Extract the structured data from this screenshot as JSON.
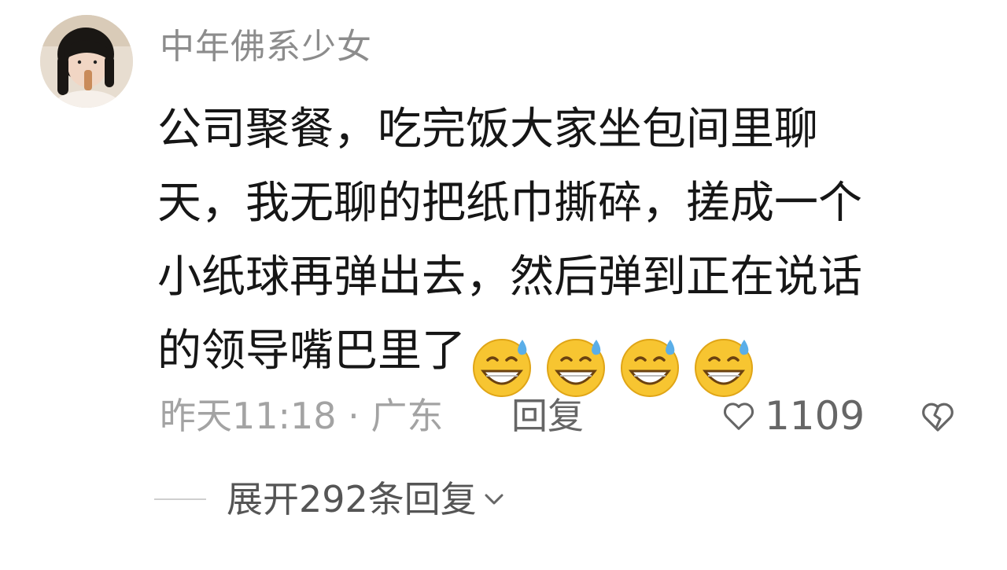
{
  "comment": {
    "username": "中年佛系少女",
    "text_lines": [
      "公司聚餐，吃完饭大家坐包间里聊",
      "天，我无聊的把纸巾撕碎，搓成一个",
      "小纸球再弹出去，然后弹到正在说话",
      "的领导嘴巴里了"
    ],
    "emojis": [
      "grinning-sweat-emoji",
      "grinning-sweat-emoji",
      "grinning-sweat-emoji",
      "grinning-sweat-emoji"
    ],
    "meta": "昨天11:18 · 广东",
    "reply_label": "回复",
    "like_count": "1109",
    "expand_label": "展开292条回复"
  },
  "icons": {
    "like": "heart-outline-icon",
    "dislike": "broken-heart-icon",
    "expand": "chevron-down-icon"
  },
  "colors": {
    "username": "#8c8c8c",
    "text": "#161616",
    "meta": "#a3a3a3",
    "action": "#666666"
  }
}
